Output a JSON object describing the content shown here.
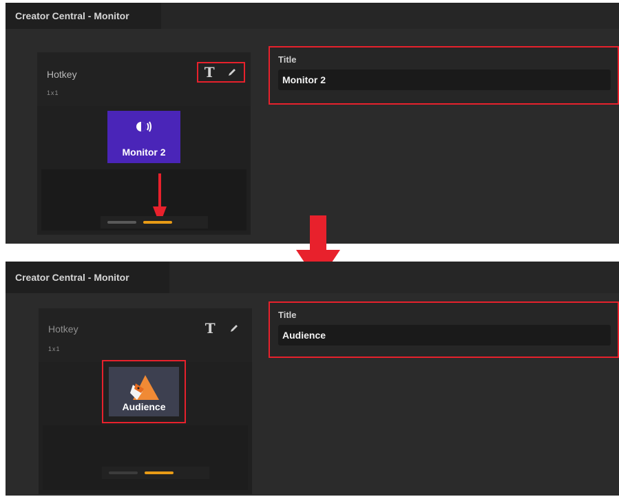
{
  "colors": {
    "accent_red": "#e8212c",
    "progress_orange": "#e89b16",
    "key_purple": "#4a25b8",
    "panel_bg": "#2b2b2b"
  },
  "before": {
    "window_title": "Creator Central - Monitor",
    "card": {
      "label": "Hotkey",
      "size": "1x1",
      "key_icon": "speaker-monitor-icon",
      "key_label": "Monitor 2"
    },
    "title_field": {
      "label": "Title",
      "value": "Monitor 2"
    }
  },
  "after": {
    "window_title": "Creator Central - Monitor",
    "card": {
      "label": "Hotkey",
      "size": "1x1",
      "key_icon": "fox-avatar-icon",
      "key_label": "Audience"
    },
    "title_field": {
      "label": "Title",
      "value": "Audience"
    }
  }
}
